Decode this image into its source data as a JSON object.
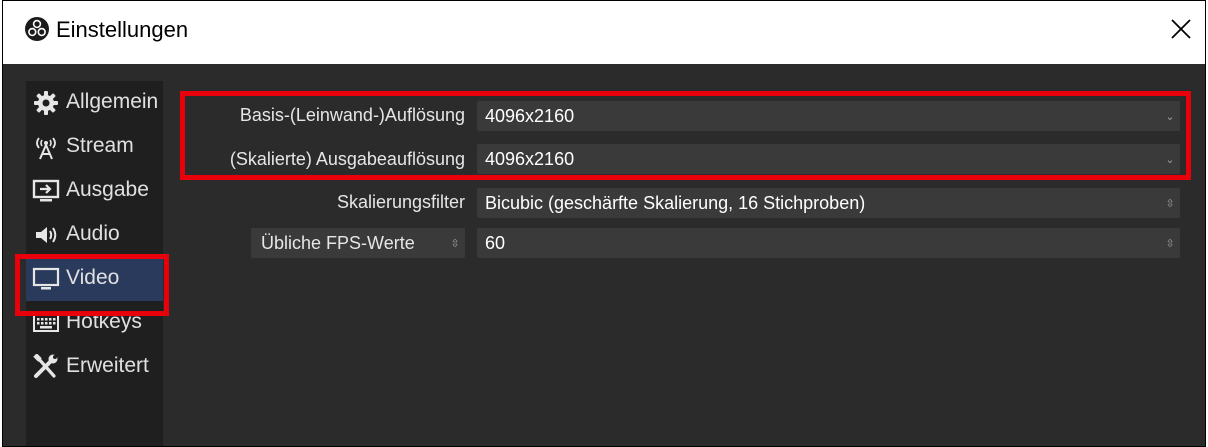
{
  "window": {
    "title": "Einstellungen",
    "logo_icon": "obs-logo-icon",
    "close_icon": "close-icon"
  },
  "sidebar": {
    "items": [
      {
        "label": "Allgemein",
        "icon": "gear-icon"
      },
      {
        "label": "Stream",
        "icon": "broadcast-antenna-icon"
      },
      {
        "label": "Ausgabe",
        "icon": "monitor-output-icon"
      },
      {
        "label": "Audio",
        "icon": "speaker-icon"
      },
      {
        "label": "Video",
        "icon": "monitor-icon",
        "selected": true
      },
      {
        "label": "Hotkeys",
        "icon": "keyboard-icon"
      },
      {
        "label": "Erweitert",
        "icon": "tools-icon"
      }
    ]
  },
  "video": {
    "base_resolution_label": "Basis-(Leinwand-)Auflösung",
    "base_resolution_value": "4096x2160",
    "output_resolution_label": "(Skalierte) Ausgabeauflösung",
    "output_resolution_value": "4096x2160",
    "downscale_filter_label": "Skalierungsfilter",
    "downscale_filter_value": "Bicubic (geschärfte Skalierung, 16 Stichproben)",
    "fps_type_value": "Übliche FPS-Werte",
    "fps_value": "60"
  },
  "colors": {
    "window_bg": "#2b2b2b",
    "sidebar_bg": "#1f1f1f",
    "selected_bg": "#2a3a5c",
    "field_bg": "#3a3a3a",
    "highlight": "#e8000b"
  }
}
